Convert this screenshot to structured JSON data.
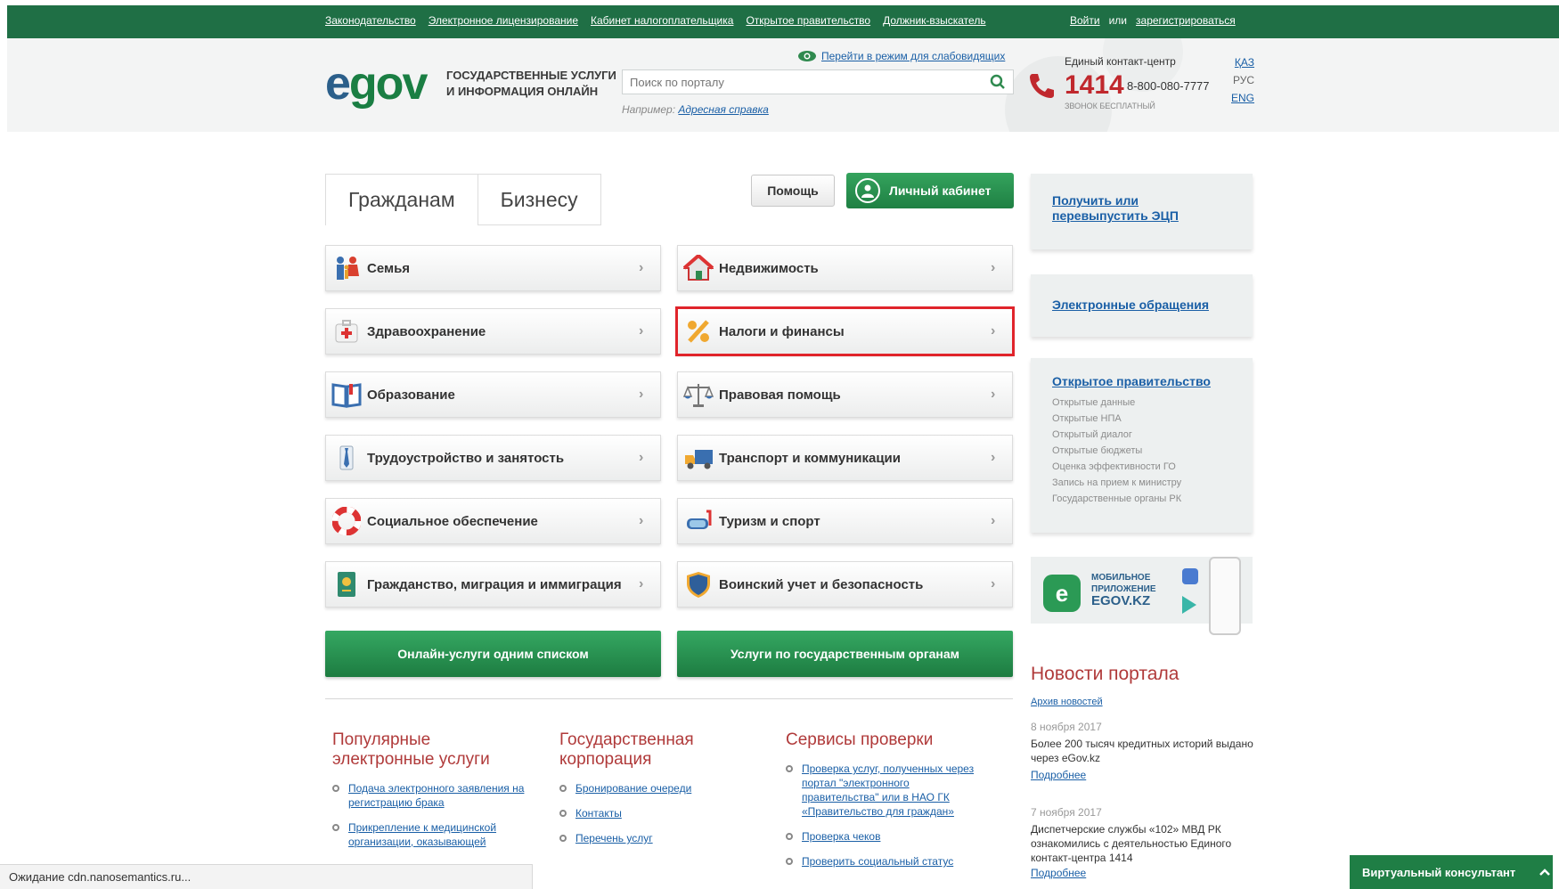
{
  "topbar": {
    "links": [
      "Законодательство",
      "Электронное лицензирование",
      "Кабинет налогоплательщика",
      "Открытое правительство",
      "Должник-взыскатель"
    ],
    "login": "Войти",
    "or": "или",
    "register": "зарегистрироваться"
  },
  "header": {
    "logo_e": "e",
    "logo_rest": "gov",
    "slogan_line1": "ГОСУДАРСТВЕННЫЕ УСЛУГИ",
    "slogan_line2": "И ИНФОРМАЦИЯ ОНЛАЙН",
    "low_vision": "Перейти в режим для слабовидящих",
    "search_placeholder": "Поиск по порталу",
    "example_label": "Например:",
    "example_link": "Адресная справка",
    "contact_label": "Единый контакт-центр",
    "contact_number": "1414",
    "contact_phone": "8-800-080-7777",
    "contact_free": "ЗВОНОК БЕСПЛАТНЫЙ",
    "lang_kaz": "ҚАЗ",
    "lang_rus": "РУС",
    "lang_eng": "ENG"
  },
  "tabs": {
    "citizens": "Гражданам",
    "business": "Бизнесу"
  },
  "buttons": {
    "help": "Помощь",
    "cabinet": "Личный кабинет"
  },
  "categories": {
    "family": "Семья",
    "realty": "Недвижимость",
    "health": "Здравоохранение",
    "taxes": "Налоги и финансы",
    "education": "Образование",
    "legal": "Правовая помощь",
    "employment": "Трудоустройство и занятость",
    "transport": "Транспорт и коммуникации",
    "social": "Социальное обеспечение",
    "tourism": "Туризм и спорт",
    "citizenship": "Гражданство, миграция и иммиграция",
    "military": "Воинский учет и безопасность"
  },
  "chevron": "›",
  "green_buttons": {
    "online": "Онлайн-услуги одним списком",
    "agencies": "Услуги по государственным органам"
  },
  "popular": {
    "title": "Популярные электронные услуги",
    "items": [
      "Подача электронного заявления на регистрацию брака",
      "Прикрепление к медицинской организации, оказывающей"
    ]
  },
  "corp": {
    "title": "Государственная корпорация",
    "items": [
      "Бронирование очереди",
      "Контакты",
      "Перечень услуг"
    ]
  },
  "check": {
    "title": "Сервисы проверки",
    "items": [
      "Проверка услуг, полученных через портал \"электронного правительства\" или в НАО ГК «Правительство для граждан»",
      "Проверка чеков",
      "Проверить социальный статус"
    ]
  },
  "sidebar": {
    "ecp": "Получить или перевыпустить ЭЦП",
    "appeals": "Электронные обращения",
    "opengov_title": "Открытое правительство",
    "opengov_items": [
      "Открытые данные",
      "Открытые НПА",
      "Открытый диалог",
      "Открытые бюджеты",
      "Оценка эффективности ГО",
      "Запись на прием к министру",
      "Государственные органы РК"
    ],
    "mobile_line1": "МОБИЛЬНОЕ",
    "mobile_line2": "ПРИЛОЖЕНИЕ",
    "mobile_line3": "EGOV.KZ",
    "mobile_badge": "e"
  },
  "news": {
    "title": "Новости портала",
    "archive": "Архив новостей",
    "items": [
      {
        "date": "8 ноября 2017",
        "text": "Более 200 тысяч кредитных историй выдано через eGov.kz",
        "more": "Подробнее"
      },
      {
        "date": "7 ноября 2017",
        "text": "Диспетчерские службы «102» МВД РК ознакомились с деятельностью Единого контакт-центра 1414",
        "more": "Подробнее"
      }
    ]
  },
  "status_bar": "Ожидание cdn.nanosemantics.ru...",
  "consultant": "Виртуальный консультант"
}
